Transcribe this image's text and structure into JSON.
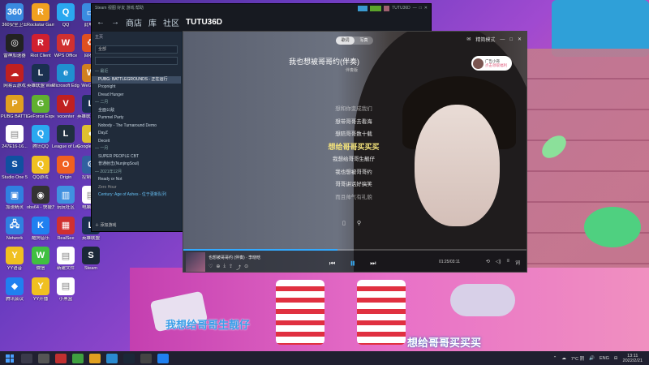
{
  "desktop_icons": [
    {
      "label": "360安全卫士",
      "color": "#3a8be0",
      "glyph": "360"
    },
    {
      "label": "Rockstar Games",
      "color": "#f0a020",
      "glyph": "R"
    },
    {
      "label": "QQ",
      "color": "#2aa8f0",
      "glyph": "Q"
    },
    {
      "label": "此电脑",
      "color": "#3a8be0",
      "glyph": "▭"
    },
    {
      "label": "雷神加速器",
      "color": "#222",
      "glyph": "◎"
    },
    {
      "label": "Riot Client",
      "color": "#d02030",
      "glyph": "R"
    },
    {
      "label": "WPS Office",
      "color": "#d03030",
      "glyph": "W"
    },
    {
      "label": "回收站",
      "color": "#e05020",
      "glyph": "♻"
    },
    {
      "label": "网易云游戏",
      "color": "#c02020",
      "glyph": "☁"
    },
    {
      "label": "英雄联盟 WeGame版",
      "color": "#1a3050",
      "glyph": "L"
    },
    {
      "label": "Microsoft Edge",
      "color": "#2090d0",
      "glyph": "e"
    },
    {
      "label": "WeGame",
      "color": "#d08020",
      "glyph": "W"
    },
    {
      "label": "PUBG BATTLEGROUNDS",
      "color": "#e0a020",
      "glyph": "P"
    },
    {
      "label": "GeForce Experience",
      "color": "#60b030",
      "glyph": "G"
    },
    {
      "label": "vocenter",
      "color": "#c02020",
      "glyph": "V"
    },
    {
      "label": "英雄联盟 WeGame版",
      "color": "#1a3050",
      "glyph": "L"
    },
    {
      "label": "247E16-16...",
      "color": "#fff",
      "glyph": "▤"
    },
    {
      "label": "腾讯QQ",
      "color": "#2aa8f0",
      "glyph": "Q"
    },
    {
      "label": "League of Legends",
      "color": "#203040",
      "glyph": "L"
    },
    {
      "label": "Google Chrome",
      "color": "#e0c030",
      "glyph": "●"
    },
    {
      "label": "Studio One 5",
      "color": "#1050a0",
      "glyph": "S"
    },
    {
      "label": "QQ游戏",
      "color": "#f0c020",
      "glyph": "Q"
    },
    {
      "label": "Origin",
      "color": "#f06020",
      "glyph": "O"
    },
    {
      "label": "控制面板",
      "color": "#3060a0",
      "glyph": "⚙"
    },
    {
      "label": "加速精灵",
      "color": "#3080e0",
      "glyph": "▣"
    },
    {
      "label": "obs64 - 快捷方式",
      "color": "#333",
      "glyph": "◉"
    },
    {
      "label": "玩玩社区",
      "color": "#4090e0",
      "glyph": "▥"
    },
    {
      "label": "电脑文件",
      "color": "#fff",
      "glyph": "▤"
    },
    {
      "label": "Network",
      "color": "#3080e0",
      "glyph": "🖧"
    },
    {
      "label": "酷狗音乐",
      "color": "#2080f0",
      "glyph": "K"
    },
    {
      "label": "RealSee",
      "color": "#d03030",
      "glyph": "▦"
    },
    {
      "label": "英雄联盟",
      "color": "#1a3050",
      "glyph": "L"
    },
    {
      "label": "YY语音",
      "color": "#f0c020",
      "glyph": "Y"
    },
    {
      "label": "微信",
      "color": "#40c040",
      "glyph": "W"
    },
    {
      "label": "新建文件",
      "color": "#fff",
      "glyph": "▤"
    },
    {
      "label": "Steam",
      "color": "#1b2838",
      "glyph": "S"
    },
    {
      "label": "腾讯会议",
      "color": "#2080f0",
      "glyph": "◆"
    },
    {
      "label": "YY开播",
      "color": "#f0c020",
      "glyph": "Y"
    },
    {
      "label": "小黑盒",
      "color": "#fff",
      "glyph": "▤"
    }
  ],
  "steam": {
    "top_left": "Steam 视图 好友 游戏 帮助",
    "nav": [
      "←",
      "→",
      "商店",
      "库",
      "社区"
    ],
    "user": "TUTU36D",
    "home": "主页",
    "filter": "全部",
    "search_placeholder": "",
    "sidebar": [
      {
        "text": "— 最近",
        "type": "hdr"
      },
      {
        "text": "PUBG: BATTLEGROUNDS - 正在运行",
        "type": "sel"
      },
      {
        "text": "Propnight",
        "type": ""
      },
      {
        "text": "Dread Hunger",
        "type": ""
      },
      {
        "text": "— 二月",
        "type": "hdr"
      },
      {
        "text": "全面公敌",
        "type": ""
      },
      {
        "text": "Pummel Party",
        "type": ""
      },
      {
        "text": "Nobody - The Turnaround Demo",
        "type": ""
      },
      {
        "text": "DayZ",
        "type": ""
      },
      {
        "text": "Deceit",
        "type": ""
      },
      {
        "text": "— 一月",
        "type": "hdr"
      },
      {
        "text": "SUPER PEOPLE CBT",
        "type": ""
      },
      {
        "text": "普通射击(NunjingSoul)",
        "type": ""
      },
      {
        "text": "— 2021年12月",
        "type": "hdr"
      },
      {
        "text": "Ready or Not",
        "type": ""
      },
      {
        "text": "Zero Hour",
        "type": "gray"
      },
      {
        "text": "Century: Age of Ashes - 位于更新队列",
        "type": "blue"
      }
    ],
    "add_game": "添加游戏"
  },
  "music": {
    "toggle": [
      "歌词",
      "写真"
    ],
    "window_controls": [
      "✉",
      "精简模式",
      "—",
      "□",
      "✕"
    ],
    "song_title": "我也想被哥哥约(伴奏)",
    "song_sub": "伴奏版",
    "user_card": {
      "name": "广告小哥",
      "action": "点击领取福利"
    },
    "lyrics": [
      {
        "text": "想和你变成我们",
        "cls": "dim"
      },
      {
        "text": "想带哥哥去看海",
        "cls": ""
      },
      {
        "text": "想陪哥哥数十载",
        "cls": ""
      },
      {
        "text": "想给哥哥买买买",
        "cls": "cur"
      },
      {
        "text": "我想给哥哥生靓仔",
        "cls": ""
      },
      {
        "text": "我也想被哥哥约",
        "cls": ""
      },
      {
        "text": "哥哥讲话好搞笑",
        "cls": ""
      },
      {
        "text": "而且帅气有礼貌",
        "cls": "dim"
      }
    ],
    "lyric_tools": [
      "▯",
      "⚲"
    ],
    "player": {
      "song": "也想被哥哥约 (伴奏) · 李晓晗",
      "icons": [
        "♡",
        "⊕",
        "⤓",
        "⇪",
        "⤴",
        "⊙"
      ],
      "prev": "⏮",
      "play": "⏸",
      "next": "⏭",
      "time": "01:25/03:11",
      "right_icons": [
        "⟲",
        "◁)",
        "≡",
        "词"
      ],
      "progress": 0.45
    }
  },
  "float_lyrics": {
    "line1": "我想给哥哥生靓仔",
    "line2": "想给哥哥买买买"
  },
  "taskbar": {
    "tray": [
      "⌃",
      "☁",
      "7°C 阴",
      "🔊",
      "ENG",
      "⊟"
    ],
    "time": "13:11",
    "date": "2022/2/21"
  }
}
